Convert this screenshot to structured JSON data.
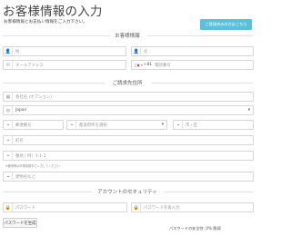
{
  "page": {
    "title": "お客様情報の入力",
    "intro": "お客様情報とお支払い情報をご入力下さい。",
    "login_button": "ご登録済みの方はこちら"
  },
  "customer_section": {
    "heading": "お客様情報",
    "last_name_placeholder": "姓",
    "first_name_placeholder": "名",
    "email_placeholder": "メールアドレス",
    "phone": {
      "dial_code": "+81",
      "placeholder": "電話番号",
      "flag": "japan-flag"
    }
  },
  "billing_section": {
    "heading": "ご請求先住所",
    "company_placeholder": "会社名 (オプション)",
    "country_value": "Japan",
    "postal_placeholder": "郵便番号",
    "prefecture_placeholder": "都道府県を選択",
    "city_placeholder": "市・区",
    "town_placeholder": "町名",
    "street_placeholder": "番地 / 例）1-1-1",
    "street_hint": "※番地等は半角英数字で入力してください",
    "building_placeholder": "建物名など"
  },
  "security_section": {
    "heading": "アカウントのセキュリティ",
    "password_placeholder": "パスワード",
    "password_confirm_placeholder": "パスワードを再入力",
    "generate_button": "パスワードを生成",
    "strength_text": "パスワードの安全性: 0% 脆弱"
  },
  "colors": {
    "accent": "#5bc0de",
    "border": "#d6d6d6",
    "placeholder": "#9a9a9a"
  }
}
